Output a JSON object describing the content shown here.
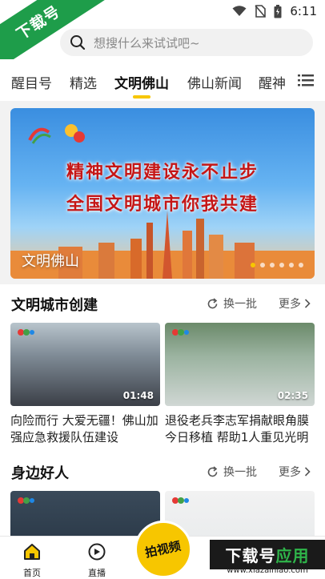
{
  "status": {
    "time": "6:11"
  },
  "corner_badge": "下载号",
  "search": {
    "placeholder": "想搜什么来试试吧~"
  },
  "tabs": [
    {
      "label": "醒目号",
      "active": false
    },
    {
      "label": "精选",
      "active": false
    },
    {
      "label": "文明佛山",
      "active": true
    },
    {
      "label": "佛山新闻",
      "active": false
    },
    {
      "label": "醒神",
      "active": false
    }
  ],
  "banner": {
    "line1": "精神文明建设永不止步",
    "line2": "全国文明城市你我共建",
    "caption": "文明佛山",
    "dots": 6,
    "active_dot": 0
  },
  "sections": [
    {
      "title": "文明城市创建",
      "refresh_label": "换一批",
      "more_label": "更多",
      "cards": [
        {
          "title": "向险而行 大爱无疆！佛山加强应急救援队伍建设",
          "duration": "01:48"
        },
        {
          "title": "退役老兵李志军捐献眼角膜今日移植 帮助1人重见光明",
          "duration": "02:35"
        }
      ]
    },
    {
      "title": "身边好人",
      "refresh_label": "换一批",
      "more_label": "更多",
      "cards": [
        {
          "title": "",
          "duration": ""
        },
        {
          "title": "",
          "duration": ""
        }
      ]
    }
  ],
  "bottom_nav": {
    "home": "首页",
    "live": "直播",
    "shoot": "拍视频"
  },
  "watermark": {
    "title_a": "下载号",
    "title_b": "应用",
    "url": "www.xiazainiao.com"
  },
  "colors": {
    "accent": "#f7c600",
    "brand_green": "#1e9d4a"
  }
}
